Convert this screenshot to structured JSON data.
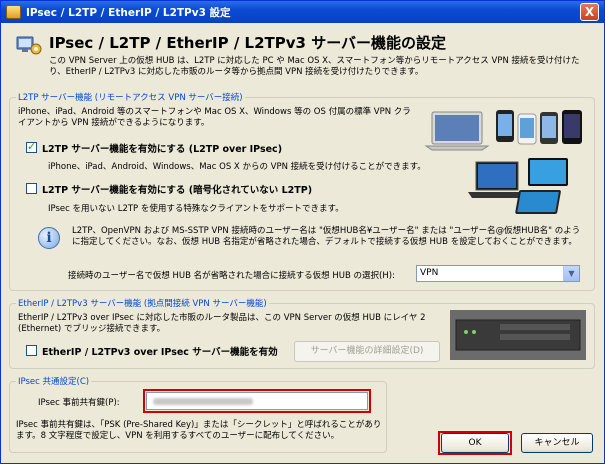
{
  "window": {
    "title": "IPsec / L2TP / EtherIP / L2TPv3 設定",
    "close_label": "X"
  },
  "header": {
    "title": "IPsec / L2TP / EtherIP / L2TPv3 サーバー機能の設定",
    "description": "この VPN Server 上の仮想 HUB は、L2TP に対応した PC や Mac OS X、スマートフォン等からリモートアクセス VPN 接続を受け付けたり、EtherIP / L2TPv3 に対応した市販のルータ等から拠点間 VPN 接続を受け付けたりできます。"
  },
  "l2tp_group": {
    "legend": "L2TP サーバー機能 (リモートアクセス VPN サーバー接続)",
    "intro": "iPhone、iPad、Android 等のスマートフォンや Mac OS X、Windows 等の OS 付属の標準 VPN クライアントから VPN 接続ができるようになります。",
    "enable_ipsec_label": "L2TP サーバー機能を有効にする (L2TP over IPsec)",
    "enable_ipsec_desc": "iPhone、iPad、Android、Windows、Mac OS X からの VPN 接続を受け付けることができます。",
    "enable_raw_label": "L2TP サーバー機能を有効にする (暗号化されていない L2TP)",
    "enable_raw_desc": "IPsec を用いない L2TP を使用する特殊なクライアントをサポートできます。",
    "info_text": "L2TP、OpenVPN および MS-SSTP VPN 接続時のユーザー名は \"仮想HUB名¥ユーザー名\" または \"ユーザー名@仮想HUB名\" のように指定してください。なお、仮想 HUB 名指定が省略された場合、デフォルトで接続する仮想 HUB を設定しておくことができます。",
    "default_hub_label": "接続時のユーザー名で仮想 HUB 名が省略された場合に接続する仮想 HUB の選択(H):",
    "default_hub_value": "VPN"
  },
  "etherip_group": {
    "legend": "EtherIP / L2TPv3 サーバー機能 (拠点間接続 VPN サーバー機能)",
    "intro": "EtherIP / L2TPv3 over IPsec に対応した市販のルータ製品は、この VPN Server の仮想 HUB にレイヤ 2 (Ethernet) でブリッジ接続できます。",
    "enable_label": "EtherIP / L2TPv3 over IPsec サーバー機能を有効",
    "detail_button": "サーバー機能の詳細設定(D)"
  },
  "psk_group": {
    "legend": "IPsec 共通設定(C)",
    "psk_label": "IPsec 事前共有鍵(P):",
    "note": "IPsec 事前共有鍵は、「PSK (Pre-Shared Key)」または「シークレット」と呼ばれることがあります。8 文字程度で設定し、VPN を利用するすべてのユーザーに配布してください。"
  },
  "buttons": {
    "ok": "OK",
    "cancel": "キャンセル"
  },
  "colors": {
    "accent": "#0046d5",
    "highlight_red": "#d00000",
    "titlebar": "#0a4ad4"
  },
  "icons": {
    "header": "network-gear-icon",
    "info": "info-icon",
    "logo": "cisco"
  }
}
